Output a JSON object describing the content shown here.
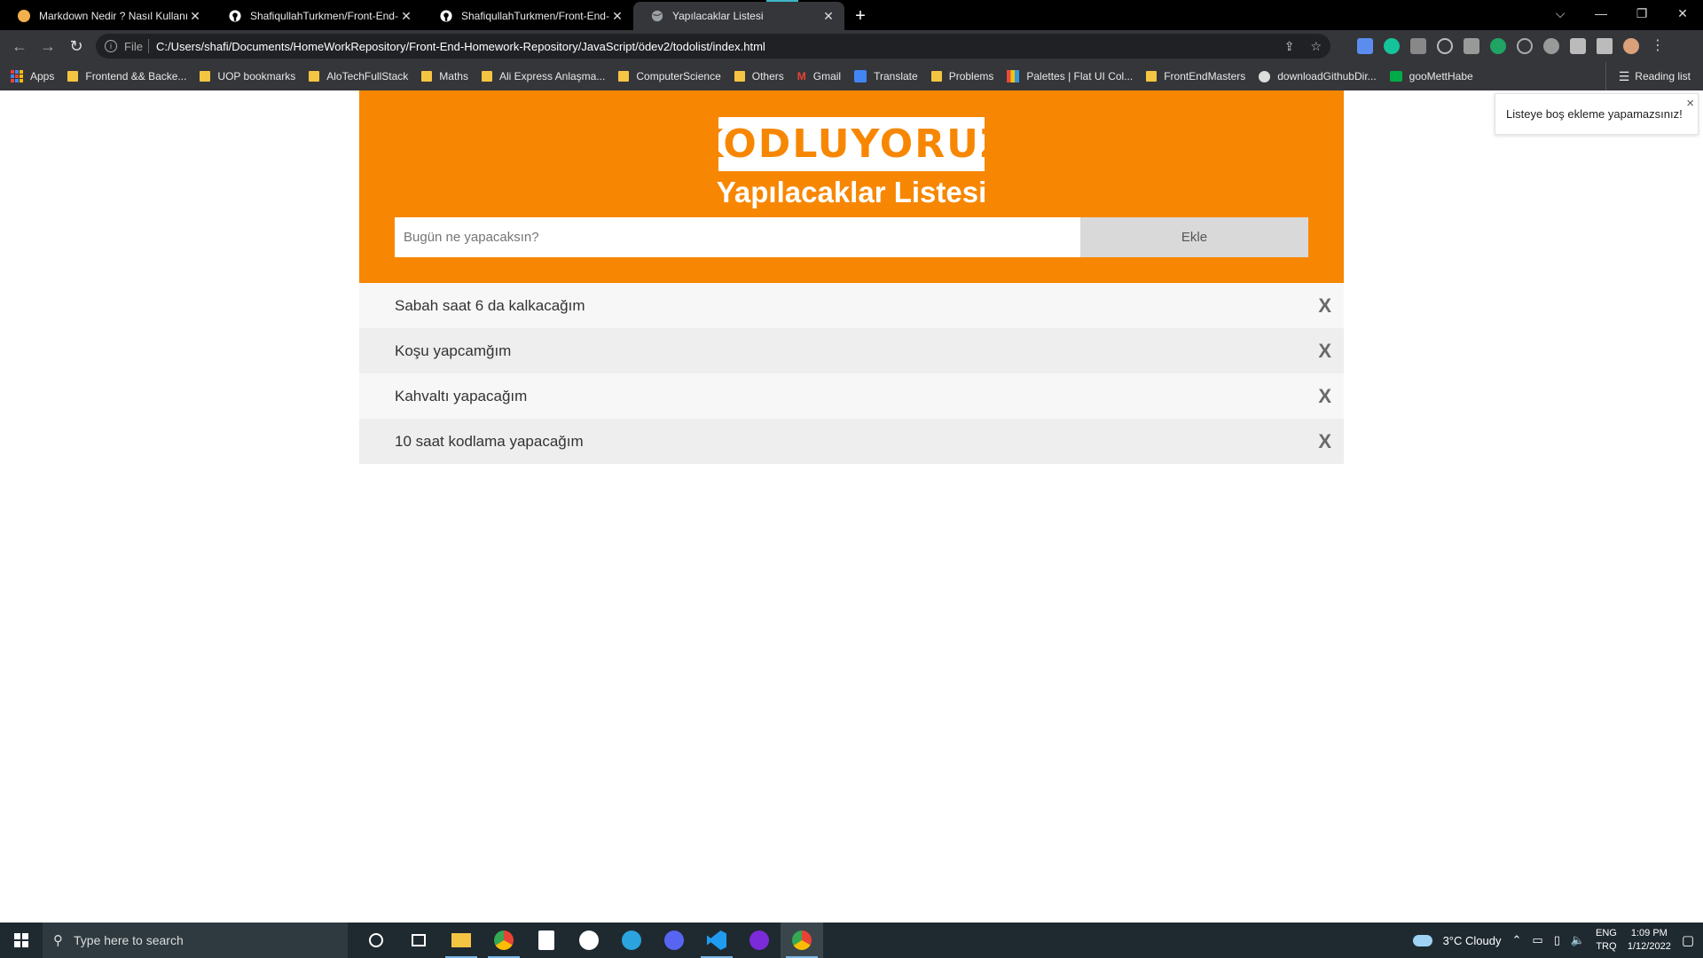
{
  "browser": {
    "tabs": [
      {
        "title": "Markdown Nedir ? Nasıl Kullanılır",
        "favicon_color": "#f4b04a"
      },
      {
        "title": "ShafiqullahTurkmen/Front-End-H",
        "favicon_color": "#ffffff"
      },
      {
        "title": "ShafiqullahTurkmen/Front-End-H",
        "favicon_color": "#ffffff"
      },
      {
        "title": "Yapılacaklar Listesi",
        "favicon_color": "#9aa0a6"
      }
    ],
    "new_tab": "+",
    "address": {
      "scheme": "File",
      "url": "C:/Users/shafi/Documents/HomeWorkRepository/Front-End-Homework-Repository/JavaScript/ödev2/todolist/index.html"
    },
    "bookmarks": [
      {
        "label": "Apps",
        "icon": "apps-grid-icon"
      },
      {
        "label": "Frontend && Backe...",
        "icon": "folder-icon"
      },
      {
        "label": "UOP bookmarks",
        "icon": "folder-icon"
      },
      {
        "label": "AloTechFullStack",
        "icon": "folder-icon"
      },
      {
        "label": "Maths",
        "icon": "folder-icon"
      },
      {
        "label": "Ali Express Anlaşma...",
        "icon": "folder-icon"
      },
      {
        "label": "ComputerScience",
        "icon": "folder-icon"
      },
      {
        "label": "Others",
        "icon": "folder-icon"
      },
      {
        "label": "Gmail",
        "icon": "gmail-icon"
      },
      {
        "label": "Translate",
        "icon": "translate-icon"
      },
      {
        "label": "Problems",
        "icon": "folder-icon"
      },
      {
        "label": "Palettes | Flat UI Col...",
        "icon": "palette-icon"
      },
      {
        "label": "FrontEndMasters",
        "icon": "folder-icon"
      },
      {
        "label": "downloadGithubDir...",
        "icon": "globe-icon"
      },
      {
        "label": "gooMettHabe",
        "icon": "meet-icon"
      }
    ],
    "reading_list": "Reading list"
  },
  "page": {
    "logo": "KODLUYORUZ",
    "title": "Yapılacaklar Listesi",
    "input_placeholder": "Bugün ne yapacaksın?",
    "add_button": "Ekle",
    "delete_symbol": "X",
    "todos": [
      "Sabah saat 6 da kalkacağım",
      "Koşu yapcamğım",
      "Kahvaltı yapacağım",
      "10 saat kodlama yapacağım"
    ],
    "toast": {
      "message": "Listeye boş ekleme yapamazsınız!",
      "close": "×"
    },
    "accent_color": "#f78702"
  },
  "taskbar": {
    "search_placeholder": "Type here to search",
    "weather": "3°C  Cloudy",
    "lang_top": "ENG",
    "lang_bottom": "TRQ",
    "time": "1:09 PM",
    "date": "1/12/2022"
  }
}
